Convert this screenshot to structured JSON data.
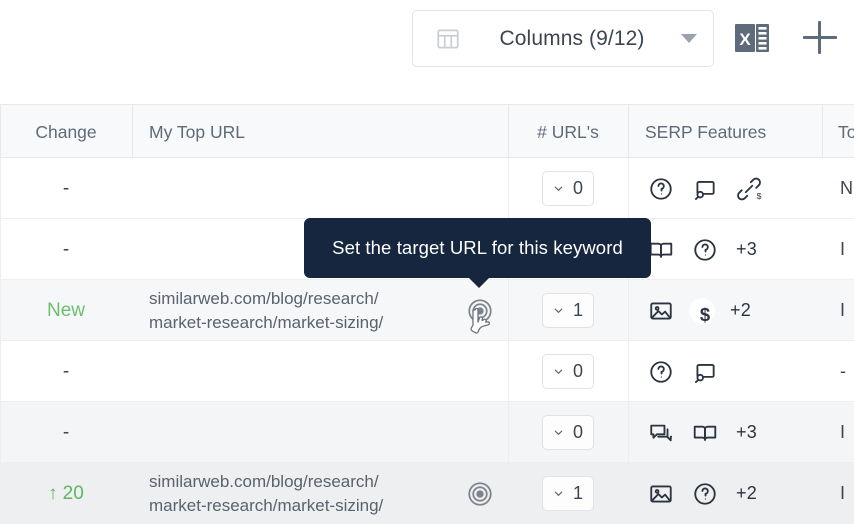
{
  "toolbar": {
    "columns_button_label": "Columns (9/12)",
    "columns_icon": "table-columns-icon",
    "dropdown_icon": "chevron-down-icon",
    "excel_icon": "excel-export-icon",
    "excel_letter": "X",
    "add_icon": "plus-icon"
  },
  "tooltip": {
    "text": "Set the target URL for this keyword"
  },
  "table": {
    "columns": [
      {
        "key": "change",
        "label": "Change",
        "align": "center"
      },
      {
        "key": "top_url",
        "label": "My Top URL",
        "align": "left"
      },
      {
        "key": "urls",
        "label": "# URL's",
        "align": "center"
      },
      {
        "key": "serp",
        "label": "SERP Features",
        "align": "left"
      },
      {
        "key": "total",
        "label": "To",
        "align": "left"
      }
    ],
    "rows": [
      {
        "change": "-",
        "change_type": "none",
        "top_url": "",
        "top_url_line2": "",
        "target_icon": "",
        "urls": "0",
        "serp_icons": [
          "question-circle-icon",
          "related-searches-icon",
          "paid-link-icon"
        ],
        "serp_more": "",
        "total": "N"
      },
      {
        "change": "-",
        "change_type": "none",
        "top_url": "",
        "top_url_line2": "",
        "target_icon": "",
        "urls": "",
        "serp_icons": [
          "book-icon",
          "question-circle-icon"
        ],
        "serp_more": "+3",
        "total": "I"
      },
      {
        "change": "New",
        "change_type": "new",
        "top_url": "similarweb.com/blog/research/",
        "top_url_line2": "market-research/market-sizing/",
        "target_icon": "target-icon",
        "urls": "1",
        "serp_icons": [
          "image-icon",
          "dollar-icon"
        ],
        "serp_more": "+2",
        "total": "I"
      },
      {
        "change": "-",
        "change_type": "none",
        "top_url": "",
        "top_url_line2": "",
        "target_icon": "",
        "urls": "0",
        "serp_icons": [
          "question-circle-icon",
          "related-searches-icon"
        ],
        "serp_more": "",
        "total": "-"
      },
      {
        "change": "-",
        "change_type": "none",
        "top_url": "",
        "top_url_line2": "",
        "target_icon": "",
        "urls": "0",
        "serp_icons": [
          "chat-bubbles-icon",
          "book-icon"
        ],
        "serp_more": "+3",
        "total": "I"
      },
      {
        "change": "20",
        "change_type": "up",
        "change_arrow": "↑",
        "top_url": "similarweb.com/blog/research/",
        "top_url_line2": "market-research/market-sizing/",
        "target_icon": "target-icon",
        "urls": "1",
        "serp_icons": [
          "image-icon",
          "question-circle-icon"
        ],
        "serp_more": "+2",
        "total": "I"
      }
    ]
  },
  "colors": {
    "tooltip_bg": "#16263f",
    "positive_green": "#6cbf6f",
    "header_text": "#5f6b78",
    "body_text": "#3c4550",
    "icon_dark": "#2c3440",
    "excel_gray": "#5d6b7a",
    "border": "#e6e8eb"
  }
}
